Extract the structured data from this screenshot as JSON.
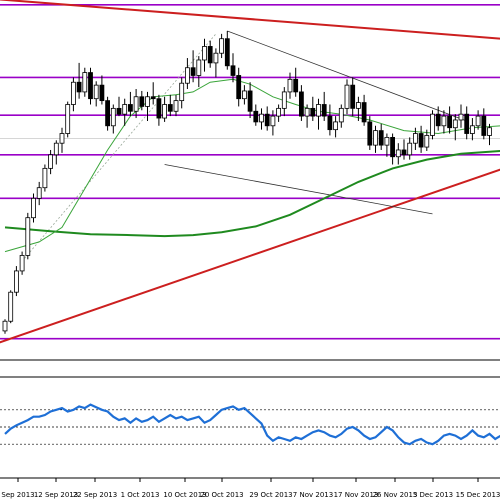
{
  "chart_data": {
    "type": "candlestick",
    "x_tick_labels": [
      "Sep 2013",
      "12 Sep 2013",
      "22 Sep 2013",
      "1 Oct 2013",
      "10 Oct 2013",
      "20 Oct 2013",
      "29 Oct 2013",
      "7 Nov 2013",
      "17 Nov 2013",
      "26 Nov 2013",
      "5 Dec 2013",
      "15 Dec 2013"
    ],
    "candles": [
      {
        "o": 28,
        "h": 40,
        "l": 25,
        "c": 38
      },
      {
        "o": 38,
        "h": 70,
        "l": 36,
        "c": 68
      },
      {
        "o": 68,
        "h": 95,
        "l": 64,
        "c": 90
      },
      {
        "o": 90,
        "h": 110,
        "l": 86,
        "c": 106
      },
      {
        "o": 106,
        "h": 150,
        "l": 102,
        "c": 145
      },
      {
        "o": 145,
        "h": 170,
        "l": 140,
        "c": 165
      },
      {
        "o": 165,
        "h": 182,
        "l": 158,
        "c": 176
      },
      {
        "o": 176,
        "h": 200,
        "l": 172,
        "c": 196
      },
      {
        "o": 196,
        "h": 215,
        "l": 190,
        "c": 210
      },
      {
        "o": 210,
        "h": 225,
        "l": 200,
        "c": 222
      },
      {
        "o": 222,
        "h": 238,
        "l": 212,
        "c": 232
      },
      {
        "o": 232,
        "h": 265,
        "l": 228,
        "c": 262
      },
      {
        "o": 262,
        "h": 290,
        "l": 255,
        "c": 285
      },
      {
        "o": 285,
        "h": 305,
        "l": 268,
        "c": 275
      },
      {
        "o": 275,
        "h": 300,
        "l": 270,
        "c": 295
      },
      {
        "o": 295,
        "h": 300,
        "l": 262,
        "c": 268
      },
      {
        "o": 268,
        "h": 286,
        "l": 260,
        "c": 282
      },
      {
        "o": 282,
        "h": 292,
        "l": 262,
        "c": 266
      },
      {
        "o": 266,
        "h": 270,
        "l": 235,
        "c": 240
      },
      {
        "o": 240,
        "h": 262,
        "l": 232,
        "c": 258
      },
      {
        "o": 258,
        "h": 270,
        "l": 250,
        "c": 252
      },
      {
        "o": 252,
        "h": 268,
        "l": 240,
        "c": 262
      },
      {
        "o": 262,
        "h": 275,
        "l": 250,
        "c": 255
      },
      {
        "o": 255,
        "h": 278,
        "l": 248,
        "c": 270
      },
      {
        "o": 270,
        "h": 276,
        "l": 256,
        "c": 260
      },
      {
        "o": 260,
        "h": 275,
        "l": 245,
        "c": 270
      },
      {
        "o": 270,
        "h": 285,
        "l": 262,
        "c": 268
      },
      {
        "o": 268,
        "h": 272,
        "l": 240,
        "c": 248
      },
      {
        "o": 248,
        "h": 270,
        "l": 244,
        "c": 262
      },
      {
        "o": 262,
        "h": 272,
        "l": 250,
        "c": 255
      },
      {
        "o": 255,
        "h": 272,
        "l": 250,
        "c": 266
      },
      {
        "o": 266,
        "h": 290,
        "l": 258,
        "c": 284
      },
      {
        "o": 284,
        "h": 310,
        "l": 278,
        "c": 300
      },
      {
        "o": 300,
        "h": 318,
        "l": 285,
        "c": 292
      },
      {
        "o": 292,
        "h": 312,
        "l": 280,
        "c": 308
      },
      {
        "o": 308,
        "h": 330,
        "l": 296,
        "c": 322
      },
      {
        "o": 322,
        "h": 328,
        "l": 300,
        "c": 305
      },
      {
        "o": 305,
        "h": 320,
        "l": 290,
        "c": 315
      },
      {
        "o": 315,
        "h": 335,
        "l": 310,
        "c": 330
      },
      {
        "o": 330,
        "h": 338,
        "l": 298,
        "c": 302
      },
      {
        "o": 302,
        "h": 315,
        "l": 285,
        "c": 292
      },
      {
        "o": 292,
        "h": 300,
        "l": 260,
        "c": 268
      },
      {
        "o": 268,
        "h": 282,
        "l": 262,
        "c": 276
      },
      {
        "o": 276,
        "h": 285,
        "l": 248,
        "c": 255
      },
      {
        "o": 255,
        "h": 262,
        "l": 240,
        "c": 244
      },
      {
        "o": 244,
        "h": 258,
        "l": 236,
        "c": 252
      },
      {
        "o": 252,
        "h": 260,
        "l": 235,
        "c": 240
      },
      {
        "o": 240,
        "h": 256,
        "l": 230,
        "c": 250
      },
      {
        "o": 250,
        "h": 262,
        "l": 244,
        "c": 258
      },
      {
        "o": 258,
        "h": 280,
        "l": 250,
        "c": 275
      },
      {
        "o": 275,
        "h": 295,
        "l": 268,
        "c": 288
      },
      {
        "o": 288,
        "h": 300,
        "l": 270,
        "c": 275
      },
      {
        "o": 275,
        "h": 282,
        "l": 245,
        "c": 250
      },
      {
        "o": 250,
        "h": 262,
        "l": 238,
        "c": 258
      },
      {
        "o": 258,
        "h": 270,
        "l": 245,
        "c": 250
      },
      {
        "o": 250,
        "h": 268,
        "l": 236,
        "c": 262
      },
      {
        "o": 262,
        "h": 275,
        "l": 245,
        "c": 250
      },
      {
        "o": 250,
        "h": 262,
        "l": 230,
        "c": 236
      },
      {
        "o": 236,
        "h": 250,
        "l": 228,
        "c": 244
      },
      {
        "o": 244,
        "h": 262,
        "l": 238,
        "c": 258
      },
      {
        "o": 258,
        "h": 288,
        "l": 252,
        "c": 282
      },
      {
        "o": 282,
        "h": 290,
        "l": 250,
        "c": 258
      },
      {
        "o": 258,
        "h": 270,
        "l": 245,
        "c": 264
      },
      {
        "o": 264,
        "h": 272,
        "l": 240,
        "c": 244
      },
      {
        "o": 244,
        "h": 250,
        "l": 215,
        "c": 220
      },
      {
        "o": 220,
        "h": 240,
        "l": 212,
        "c": 235
      },
      {
        "o": 235,
        "h": 242,
        "l": 215,
        "c": 220
      },
      {
        "o": 220,
        "h": 232,
        "l": 208,
        "c": 228
      },
      {
        "o": 228,
        "h": 232,
        "l": 200,
        "c": 208
      },
      {
        "o": 208,
        "h": 222,
        "l": 200,
        "c": 215
      },
      {
        "o": 215,
        "h": 226,
        "l": 205,
        "c": 210
      },
      {
        "o": 210,
        "h": 228,
        "l": 205,
        "c": 222
      },
      {
        "o": 222,
        "h": 238,
        "l": 215,
        "c": 232
      },
      {
        "o": 232,
        "h": 240,
        "l": 212,
        "c": 218
      },
      {
        "o": 218,
        "h": 236,
        "l": 214,
        "c": 230
      },
      {
        "o": 230,
        "h": 256,
        "l": 226,
        "c": 252
      },
      {
        "o": 252,
        "h": 260,
        "l": 235,
        "c": 240
      },
      {
        "o": 240,
        "h": 256,
        "l": 232,
        "c": 250
      },
      {
        "o": 250,
        "h": 260,
        "l": 232,
        "c": 238
      },
      {
        "o": 238,
        "h": 252,
        "l": 225,
        "c": 246
      },
      {
        "o": 246,
        "h": 262,
        "l": 238,
        "c": 252
      },
      {
        "o": 252,
        "h": 260,
        "l": 226,
        "c": 232
      },
      {
        "o": 232,
        "h": 248,
        "l": 225,
        "c": 240
      },
      {
        "o": 240,
        "h": 256,
        "l": 236,
        "c": 250
      },
      {
        "o": 250,
        "h": 258,
        "l": 226,
        "c": 230
      },
      {
        "o": 230,
        "h": 242,
        "l": 220,
        "c": 238
      }
    ],
    "ylim": [
      0,
      370
    ],
    "horizontal_levels": [
      365,
      290,
      251,
      210,
      165,
      20
    ],
    "sma_slow": [
      [
        0,
        135
      ],
      [
        8,
        131
      ],
      [
        15,
        128
      ],
      [
        22,
        127
      ],
      [
        28,
        126
      ],
      [
        33,
        127
      ],
      [
        38,
        130
      ],
      [
        44,
        136
      ],
      [
        50,
        148
      ],
      [
        56,
        165
      ],
      [
        62,
        182
      ],
      [
        68,
        196
      ],
      [
        74,
        205
      ],
      [
        80,
        211
      ],
      [
        87,
        214
      ]
    ],
    "sma_fast": [
      [
        0,
        110
      ],
      [
        6,
        120
      ],
      [
        10,
        135
      ],
      [
        14,
        175
      ],
      [
        18,
        215
      ],
      [
        22,
        250
      ],
      [
        26,
        270
      ],
      [
        30,
        272
      ],
      [
        33,
        275
      ],
      [
        36,
        285
      ],
      [
        40,
        288
      ],
      [
        43,
        283
      ],
      [
        47,
        270
      ],
      [
        51,
        262
      ],
      [
        55,
        255
      ],
      [
        59,
        252
      ],
      [
        64,
        246
      ],
      [
        70,
        235
      ],
      [
        76,
        232
      ],
      [
        82,
        238
      ],
      [
        87,
        240
      ]
    ],
    "red_top_line": [
      [
        -4,
        372
      ],
      [
        87,
        330
      ]
    ],
    "red_support_line": [
      [
        -1,
        16
      ],
      [
        87,
        195
      ]
    ],
    "channel_upper": [
      [
        39,
        338
      ],
      [
        81,
        245
      ]
    ],
    "channel_lower": [
      [
        28,
        200
      ],
      [
        75,
        149
      ]
    ],
    "dotted_trend": [
      [
        3,
        100
      ],
      [
        37,
        335
      ]
    ],
    "oscillator": {
      "ylim": [
        0,
        100
      ],
      "levels": [
        70,
        50,
        30
      ],
      "values": [
        42,
        48,
        52,
        55,
        58,
        62,
        62,
        64,
        68,
        70,
        72,
        68,
        70,
        74,
        72,
        76,
        73,
        70,
        68,
        62,
        58,
        60,
        55,
        60,
        56,
        58,
        62,
        56,
        60,
        64,
        60,
        62,
        58,
        60,
        62,
        55,
        58,
        64,
        70,
        72,
        74,
        70,
        72,
        66,
        60,
        54,
        40,
        34,
        38,
        36,
        34,
        38,
        36,
        40,
        44,
        46,
        44,
        40,
        38,
        42,
        48,
        50,
        46,
        40,
        36,
        38,
        44,
        50,
        46,
        38,
        32,
        30,
        34,
        36,
        32,
        30,
        34,
        40,
        42,
        40,
        36,
        40,
        46,
        40,
        38,
        42,
        36,
        40,
        44,
        42,
        38
      ]
    }
  }
}
